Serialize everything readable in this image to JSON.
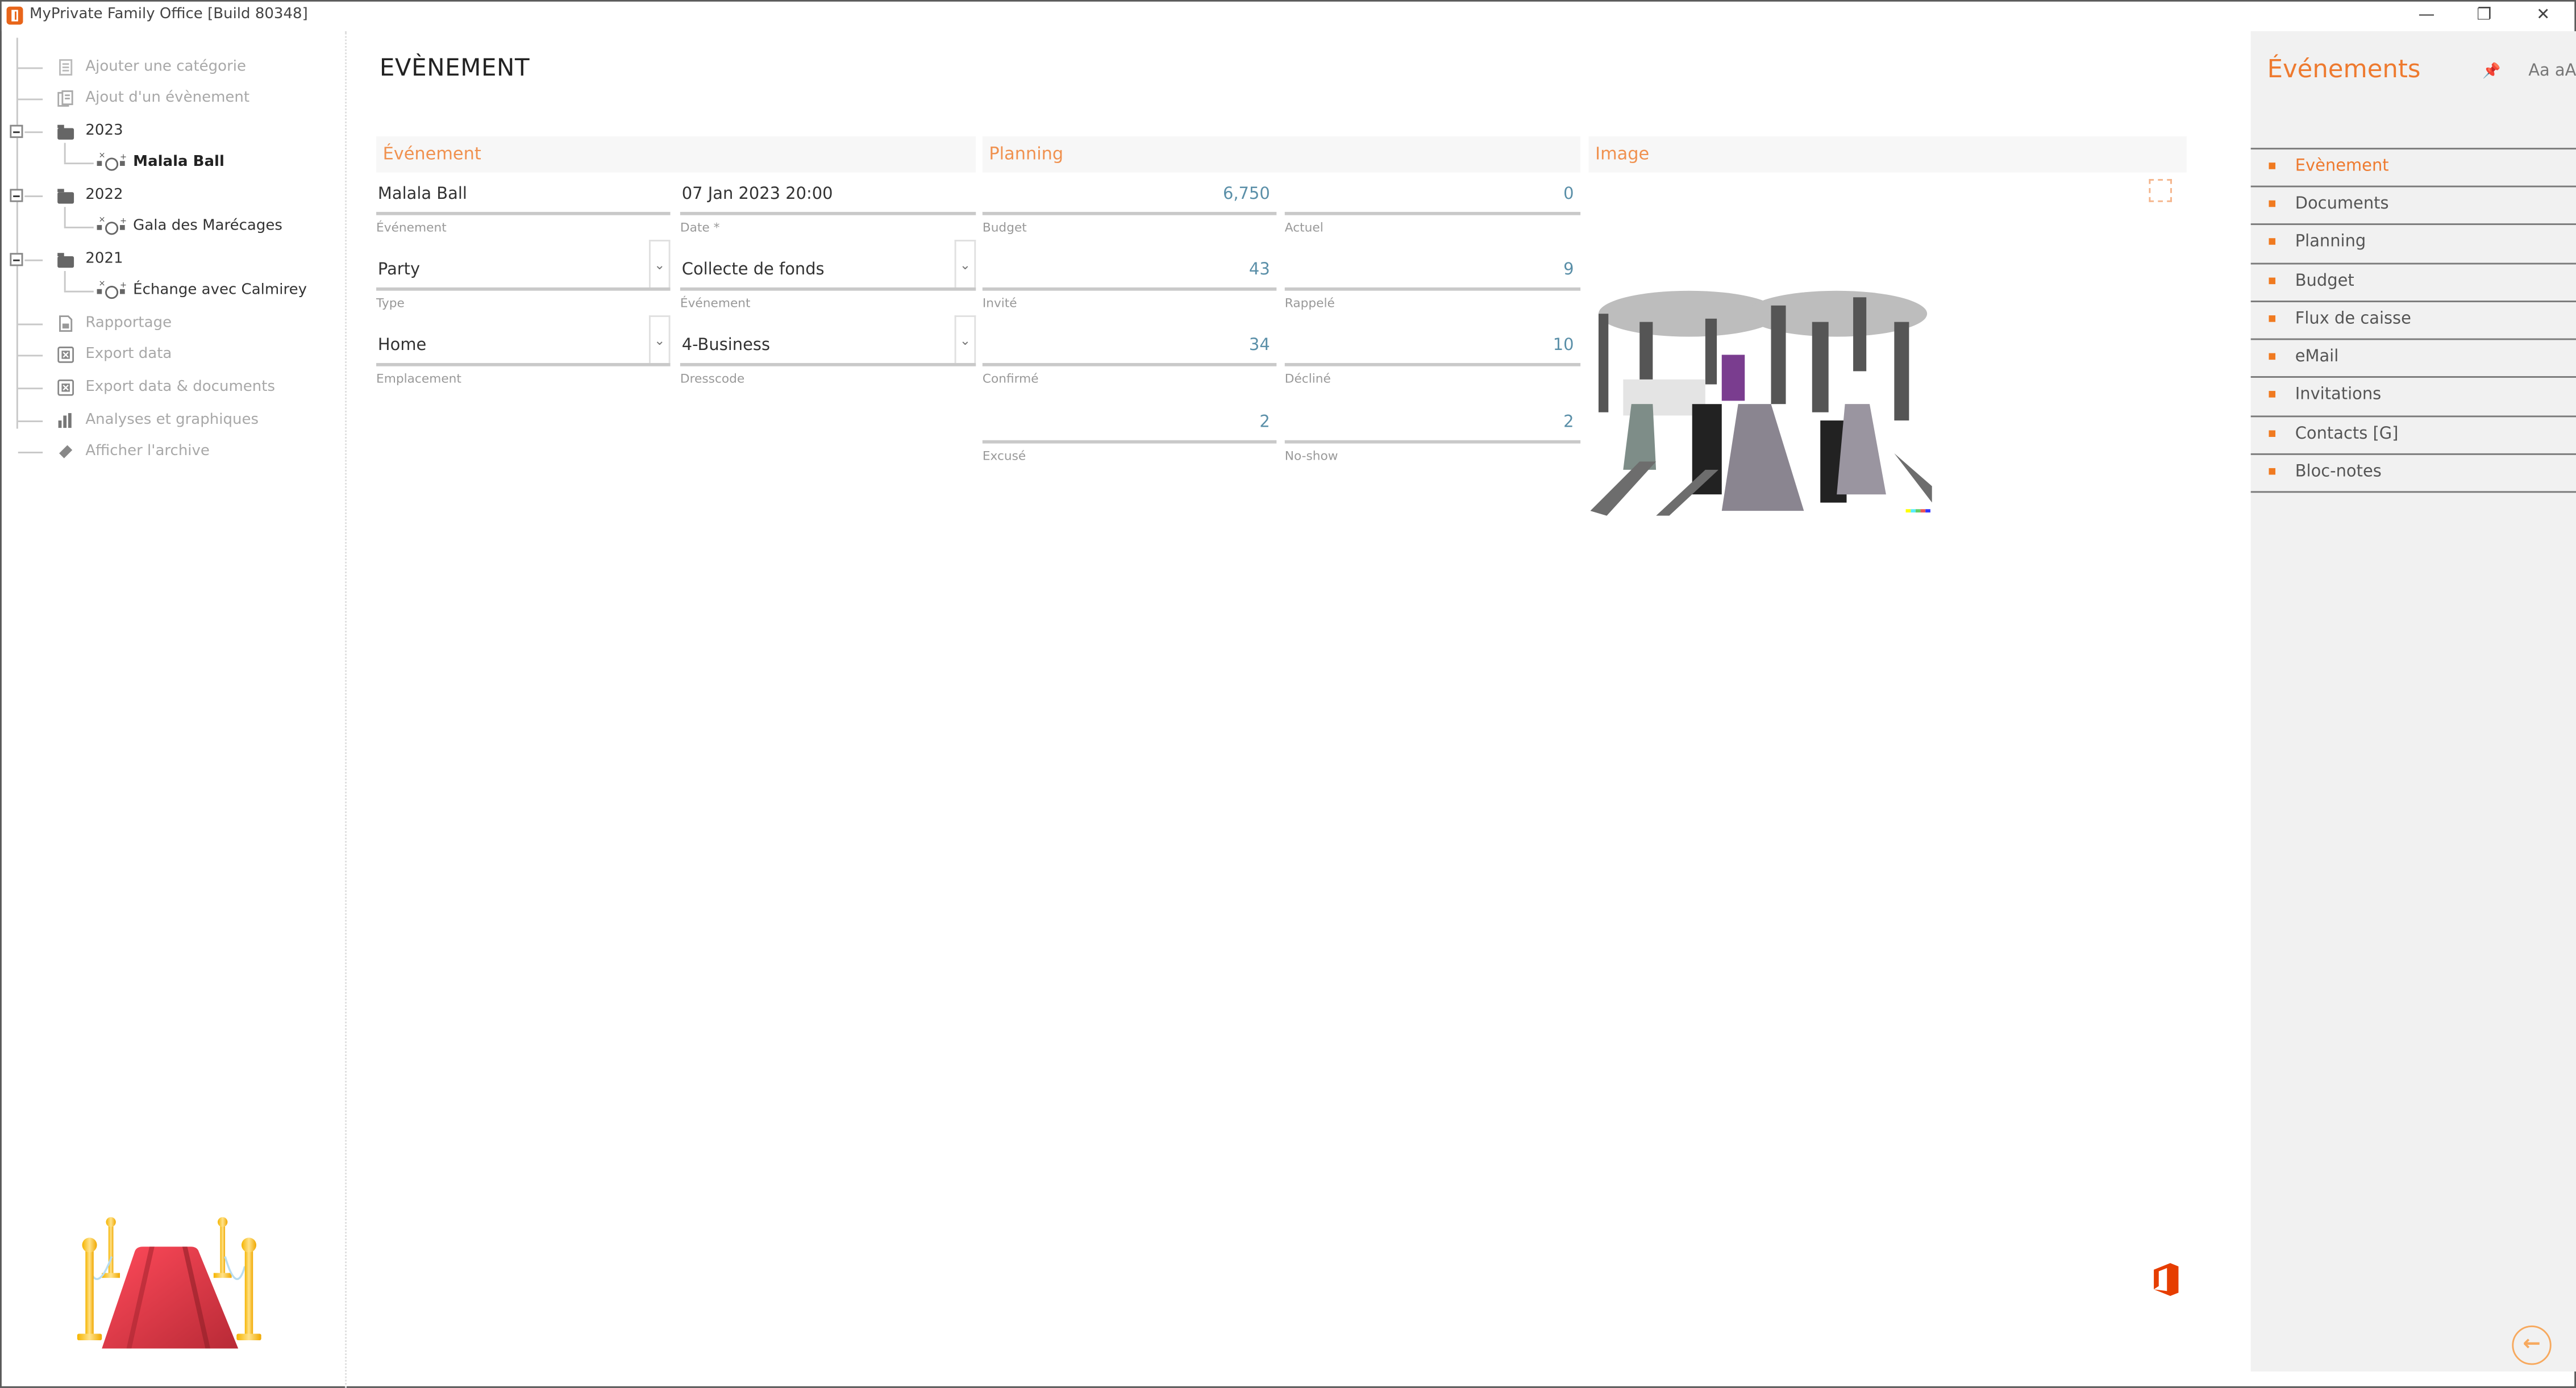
{
  "window": {
    "title": "MyPrivate Family Office [Build 80348]",
    "controls": {
      "minimize": "—",
      "restore": "❐",
      "close": "✕"
    }
  },
  "tree": {
    "actions_top": [
      {
        "label": "Ajouter une catégorie",
        "icon": "add-category-icon"
      },
      {
        "label": "Ajout d'un évènement",
        "icon": "add-event-icon"
      }
    ],
    "years": [
      {
        "year": "2023",
        "events": [
          {
            "label": "Malala Ball",
            "selected": true
          }
        ]
      },
      {
        "year": "2022",
        "events": [
          {
            "label": "Gala des Marécages",
            "selected": false
          }
        ]
      },
      {
        "year": "2021",
        "events": [
          {
            "label": "Échange avec Calmirey",
            "selected": false
          }
        ]
      }
    ],
    "actions_bottom": [
      {
        "label": "Rapportage",
        "icon": "report-icon"
      },
      {
        "label": "Export data",
        "icon": "excel-export-icon"
      },
      {
        "label": "Export data & documents",
        "icon": "excel-export-icon"
      },
      {
        "label": "Analyses et graphiques",
        "icon": "bar-chart-icon"
      },
      {
        "label": "Afficher l'archive",
        "icon": "archive-icon"
      }
    ]
  },
  "main": {
    "page_title": "EVÈNEMENT",
    "sections": {
      "event": {
        "header": "Événement",
        "fields": {
          "name": {
            "value": "Malala Ball",
            "caption": "Événement"
          },
          "date": {
            "value": "07 Jan 2023 20:00",
            "caption": "Date *"
          },
          "type": {
            "value": "Party",
            "caption": "Type"
          },
          "event_kind": {
            "value": "Collecte de fonds",
            "caption": "Événement"
          },
          "location": {
            "value": "Home",
            "caption": "Emplacement"
          },
          "dresscode": {
            "value": "4-Business",
            "caption": "Dresscode"
          }
        }
      },
      "planning": {
        "header": "Planning",
        "fields": {
          "budget": {
            "value": "6,750",
            "caption": "Budget"
          },
          "actual": {
            "value": "0",
            "caption": "Actuel"
          },
          "invited": {
            "value": "43",
            "caption": "Invité"
          },
          "reminded": {
            "value": "9",
            "caption": "Rappelé"
          },
          "confirmed": {
            "value": "34",
            "caption": "Confirmé"
          },
          "declined": {
            "value": "10",
            "caption": "Décliné"
          },
          "excused": {
            "value": "2",
            "caption": "Excusé"
          },
          "no_show": {
            "value": "2",
            "caption": "No-show"
          }
        }
      },
      "image": {
        "header": "Image"
      }
    },
    "dropdown_glyph": "⌄"
  },
  "right_panel": {
    "title": "Événements",
    "pin_glyph": "📌",
    "font_toggle": "Aa aA",
    "items": [
      {
        "label": "Evènement",
        "active": true
      },
      {
        "label": "Documents",
        "active": false
      },
      {
        "label": "Planning",
        "active": false
      },
      {
        "label": "Budget",
        "active": false
      },
      {
        "label": "Flux de caisse",
        "active": false
      },
      {
        "label": "eMail",
        "active": false
      },
      {
        "label": "Invitations",
        "active": false
      },
      {
        "label": "Contacts [G]",
        "active": false
      },
      {
        "label": "Bloc-notes",
        "active": false
      }
    ],
    "back_glyph": "←"
  },
  "colors": {
    "accent": "#ee7a2f",
    "section_header": "#f0914f",
    "numeric_value": "#5a8fa8",
    "panel_bg": "#f1f1f1",
    "office_red": "#e63d00"
  }
}
